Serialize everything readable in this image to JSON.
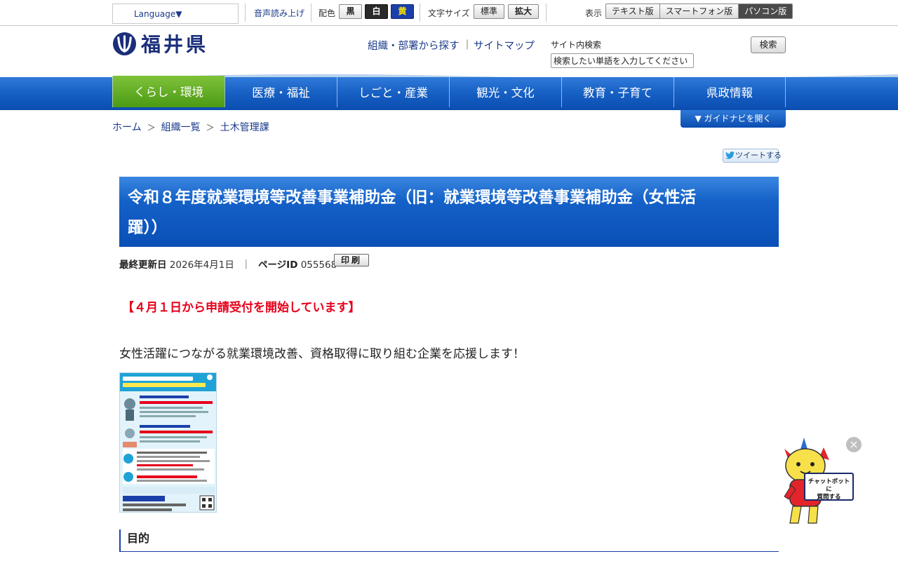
{
  "topbar": {
    "language_label": "Language▼",
    "voice_reader": "音声読み上げ",
    "color_label": "配色",
    "color_black": "黒",
    "color_white": "白",
    "color_yellow": "黄",
    "fontsize_label": "文字サイズ",
    "fontsize_standard": "標準",
    "fontsize_large": "拡大",
    "view_label": "表示",
    "view_text": "テキスト版",
    "view_smartphone": "スマートフォン版",
    "view_pc": "パソコン版"
  },
  "header": {
    "logo_text": "福井県",
    "link_org": "組織・部署から探す",
    "separator": "｜",
    "link_sitemap": "サイトマップ",
    "search_label": "サイト内検索",
    "search_placeholder": "検索したい単語を入力してください",
    "search_button": "検索"
  },
  "nav": {
    "items": [
      {
        "label": "くらし・環境"
      },
      {
        "label": "医療・福祉"
      },
      {
        "label": "しごと・産業"
      },
      {
        "label": "観光・文化"
      },
      {
        "label": "教育・子育て"
      },
      {
        "label": "県政情報"
      }
    ],
    "active_index": 0
  },
  "breadcrumb": {
    "items": [
      "ホーム",
      "組織一覧",
      "土木管理課"
    ],
    "separator": "＞"
  },
  "guide_button": "▼  ガイドナビを開く",
  "tweet_button": "ツイートする",
  "page": {
    "title_line1": "令和８年度就業環境等改善事業補助金（旧：就業環境等改善事業補助金（女性活",
    "title_line2": "躍））",
    "updated_label": "最終更新日",
    "updated_value": "2026年4月1日",
    "meta_sep": "｜",
    "page_id_label": "ページID",
    "page_id_value": "055568",
    "print_button": "印刷",
    "notice": "【４月１日から申請受付を開始しています】",
    "lead": "女性活躍につながる就業環境改善、資格取得に取り組む企業を応援します！",
    "section_heading": "目的"
  },
  "chatbot": {
    "bubble_line1": "チャットボットに",
    "bubble_line2": "質問する",
    "close_symbol": "×"
  },
  "colors": {
    "brand_blue": "#1b3faa",
    "nav_blue": "#165fc3",
    "nav_active_green": "#5aa51c",
    "notice_red": "#e5001a"
  }
}
